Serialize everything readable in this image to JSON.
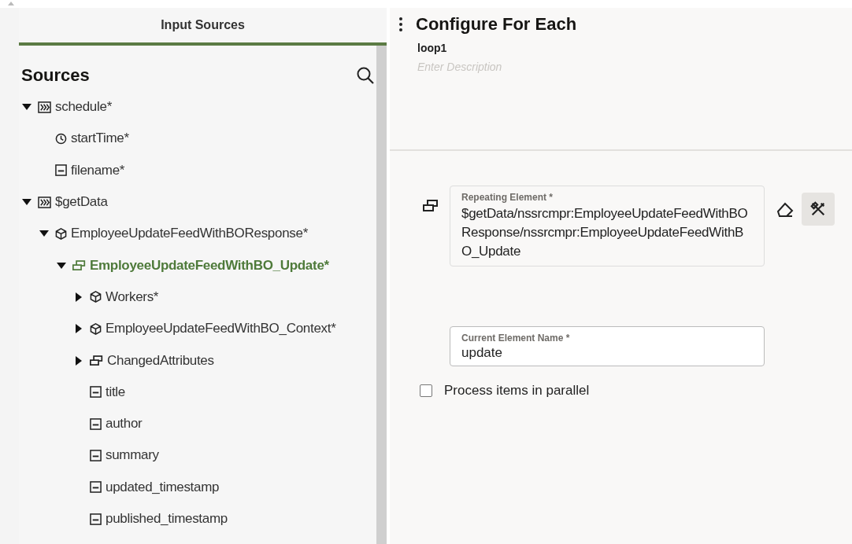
{
  "left_panel": {
    "tab": {
      "label": "Input Sources",
      "selected": true
    },
    "heading": "Sources",
    "tree": [
      {
        "label": "schedule*",
        "kind": "group",
        "expanded": true,
        "selected": false,
        "children": [
          {
            "label": "startTime*",
            "kind": "time",
            "selected": false
          },
          {
            "label": "filename*",
            "kind": "text",
            "selected": false
          }
        ]
      },
      {
        "label": "$getData",
        "kind": "group",
        "expanded": true,
        "selected": false,
        "children": [
          {
            "label": "EmployeeUpdateFeedWithBOResponse*",
            "kind": "object",
            "expanded": true,
            "selected": false,
            "children": [
              {
                "label": "EmployeeUpdateFeedWithBO_Update*",
                "kind": "array",
                "expanded": true,
                "selected": true,
                "children": [
                  {
                    "label": "Workers*",
                    "kind": "object",
                    "expanded": false,
                    "selected": false
                  },
                  {
                    "label": "EmployeeUpdateFeedWithBO_Context*",
                    "kind": "object",
                    "expanded": false,
                    "selected": false
                  },
                  {
                    "label": "ChangedAttributes",
                    "kind": "array",
                    "expanded": false,
                    "selected": false
                  },
                  {
                    "label": "title",
                    "kind": "text",
                    "selected": false
                  },
                  {
                    "label": "author",
                    "kind": "text",
                    "selected": false
                  },
                  {
                    "label": "summary",
                    "kind": "text",
                    "selected": false
                  },
                  {
                    "label": "updated_timestamp",
                    "kind": "text",
                    "selected": false
                  },
                  {
                    "label": "published_timestamp",
                    "kind": "text",
                    "selected": false
                  }
                ]
              }
            ]
          }
        ]
      }
    ]
  },
  "config": {
    "title": "Configure For Each",
    "name": "loop1",
    "description": {
      "placeholder": "Enter Description"
    },
    "repeating_element": {
      "label": "Repeating Element *",
      "value": "$getData/nssrcmpr:EmployeeUpdateFeedWithBOResponse/nssrcmpr:EmployeeUpdateFeedWithBO_Update"
    },
    "current_element_name": {
      "label": "Current Element Name *",
      "value": "update"
    },
    "parallel": {
      "label": "Process items in parallel",
      "checked": false
    }
  }
}
